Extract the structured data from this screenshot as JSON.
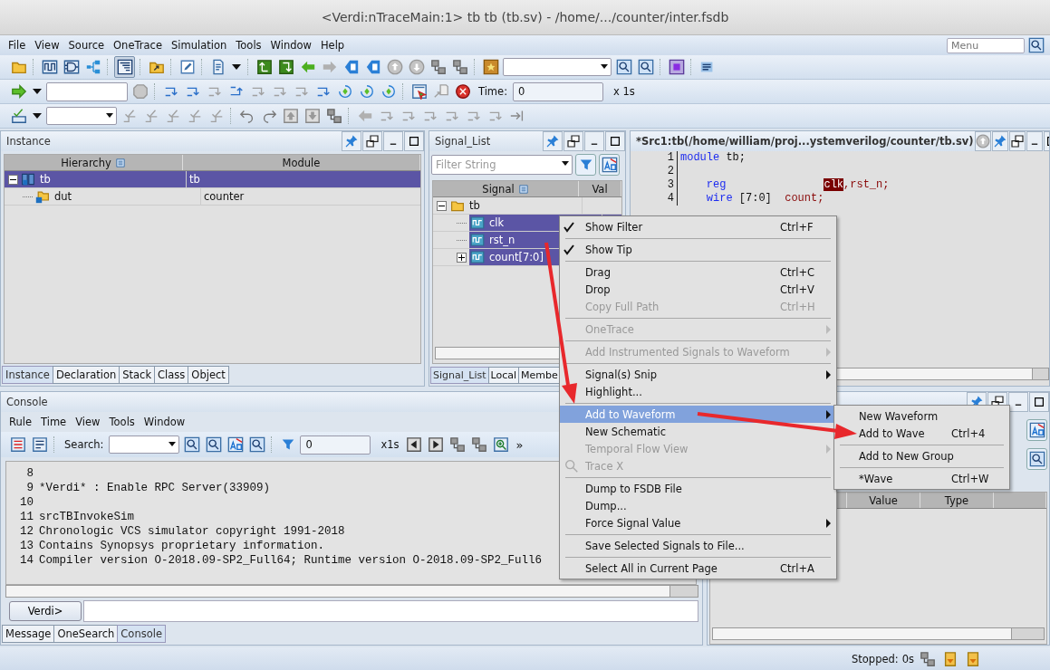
{
  "window": {
    "title": "<Verdi:nTraceMain:1> tb tb (tb.sv) - /home/.../counter/inter.fsdb"
  },
  "menu_bar": {
    "items": [
      "File",
      "View",
      "Source",
      "OneTrace",
      "Simulation",
      "Tools",
      "Window",
      "Help"
    ],
    "search": {
      "placeholder": "Menu"
    }
  },
  "toolbar_time": {
    "label": "Time:",
    "value": "0",
    "unit": "x 1s"
  },
  "instance_panel": {
    "title": "Instance",
    "columns": [
      "Hierarchy",
      "Module"
    ],
    "rows": [
      {
        "name": "tb",
        "module": "tb",
        "selected": true,
        "expanded": true,
        "children": [
          {
            "name": "dut",
            "module": "counter",
            "selected": false
          }
        ]
      }
    ],
    "tabs": [
      {
        "label": "Instance",
        "selected": true
      },
      {
        "label": "Declaration",
        "selected": false
      },
      {
        "label": "Stack",
        "selected": false
      },
      {
        "label": "Class",
        "selected": false
      },
      {
        "label": "Object",
        "selected": false
      }
    ]
  },
  "signal_panel": {
    "title": "Signal_List",
    "filter": {
      "placeholder": "Filter String"
    },
    "columns": [
      "Signal",
      "Val"
    ],
    "tree": [
      {
        "name": "tb",
        "selected": false,
        "expanded": true,
        "children": [
          {
            "name": "clk",
            "selected": true
          },
          {
            "name": "rst_n",
            "selected": true
          },
          {
            "name": "count[7:0]",
            "selected": true,
            "expanded": false
          }
        ]
      }
    ],
    "tabs": [
      {
        "label": "Signal_List",
        "selected": true
      },
      {
        "label": "Local",
        "selected": false
      },
      {
        "label": "Membe",
        "selected": false
      }
    ]
  },
  "source_panel": {
    "title": "*Src1:tb(/home/william/proj...ystemverilog/counter/tb.sv)",
    "lines": [
      {
        "number": "1",
        "tokens": [
          {
            "text": "module",
            "kind": "keyword"
          },
          {
            "text": " tb;",
            "kind": "plain"
          }
        ]
      },
      {
        "number": "2"
      },
      {
        "number": "3",
        "tokens": [
          {
            "text": "    reg               ",
            "kind": "keyword"
          },
          {
            "text": "clk",
            "kind": "highlight"
          },
          {
            "text": ",rst_n;",
            "kind": "identifier"
          }
        ]
      },
      {
        "number": "4",
        "tokens": [
          {
            "text": "    wire",
            "kind": "keyword"
          },
          {
            "text": " [7:0]  ",
            "kind": "plain"
          },
          {
            "text": "count;",
            "kind": "identifier"
          }
        ]
      }
    ]
  },
  "console_panel": {
    "title": "Console",
    "menu": [
      "Rule",
      "Time",
      "View",
      "Tools",
      "Window"
    ],
    "search_label": "Search:",
    "field_value": "0",
    "unit": "x1s",
    "more": "»",
    "lines": [
      {
        "number": "8"
      },
      {
        "number": "9",
        "text": "*Verdi* : Enable RPC Server(33909)"
      },
      {
        "number": "10"
      },
      {
        "number": "11",
        "text": "srcTBInvokeSim"
      },
      {
        "number": "12",
        "text": "Chronologic VCS simulator copyright 1991-2018"
      },
      {
        "number": "13",
        "text": "Contains Synopsys proprietary information."
      },
      {
        "number": "14",
        "text": "Compiler version O-2018.09-SP2_Full64; Runtime version O-2018.09-SP2_Full6"
      }
    ],
    "prompt_button": "Verdi>",
    "tabs": [
      {
        "label": "Message",
        "selected": false
      },
      {
        "label": "OneSearch",
        "selected": false
      },
      {
        "label": "Console",
        "selected": true
      }
    ]
  },
  "wave_panel": {
    "columns": [
      "Value",
      "Type"
    ]
  },
  "context_menu": {
    "items": [
      {
        "kind": "item",
        "label": "Show Filter",
        "shortcut": "Ctrl+F",
        "checked": true,
        "disabled": false,
        "submenu": false,
        "selected": false
      },
      {
        "kind": "separator"
      },
      {
        "kind": "item",
        "label": "Show Tip",
        "checked": true,
        "disabled": false,
        "submenu": false,
        "selected": false
      },
      {
        "kind": "separator"
      },
      {
        "kind": "item",
        "label": "Drag",
        "shortcut": "Ctrl+C",
        "checked": false,
        "disabled": false,
        "submenu": false,
        "selected": false
      },
      {
        "kind": "item",
        "label": "Drop",
        "shortcut": "Ctrl+V",
        "checked": false,
        "disabled": false,
        "submenu": false,
        "selected": false
      },
      {
        "kind": "item",
        "label": "Copy Full Path",
        "shortcut": "Ctrl+H",
        "checked": false,
        "disabled": true,
        "submenu": false,
        "selected": false
      },
      {
        "kind": "separator"
      },
      {
        "kind": "item",
        "label": "OneTrace",
        "checked": false,
        "disabled": true,
        "submenu": true,
        "selected": false
      },
      {
        "kind": "separator"
      },
      {
        "kind": "item",
        "label": "Add Instrumented Signals to Waveform",
        "checked": false,
        "disabled": true,
        "submenu": true,
        "selected": false
      },
      {
        "kind": "separator"
      },
      {
        "kind": "item",
        "label": "Signal(s) Snip",
        "checked": false,
        "disabled": false,
        "submenu": true,
        "selected": false
      },
      {
        "kind": "item",
        "label": "Highlight...",
        "checked": false,
        "disabled": false,
        "submenu": false,
        "selected": false
      },
      {
        "kind": "separator"
      },
      {
        "kind": "item",
        "label": "Add to Waveform",
        "checked": false,
        "disabled": false,
        "submenu": true,
        "selected": true
      },
      {
        "kind": "item",
        "label": "New Schematic",
        "checked": false,
        "disabled": false,
        "submenu": false,
        "selected": false
      },
      {
        "kind": "item",
        "label": "Temporal Flow View",
        "checked": false,
        "disabled": true,
        "submenu": true,
        "selected": false
      },
      {
        "kind": "icon_item",
        "label": "Trace X",
        "checked": false,
        "disabled": true,
        "submenu": false,
        "selected": false
      },
      {
        "kind": "separator"
      },
      {
        "kind": "item",
        "label": "Dump to FSDB File",
        "checked": false,
        "disabled": false,
        "submenu": false,
        "selected": false
      },
      {
        "kind": "item",
        "label": "Dump...",
        "checked": false,
        "disabled": false,
        "submenu": false,
        "selected": false
      },
      {
        "kind": "item",
        "label": "Force Signal Value",
        "checked": false,
        "disabled": false,
        "submenu": true,
        "selected": false
      },
      {
        "kind": "separator"
      },
      {
        "kind": "item",
        "label": "Save Selected Signals to File...",
        "checked": false,
        "disabled": false,
        "submenu": false,
        "selected": false
      },
      {
        "kind": "separator"
      },
      {
        "kind": "item",
        "label": "Select All in Current Page",
        "shortcut": "Ctrl+A",
        "checked": false,
        "disabled": false,
        "submenu": false,
        "selected": false
      }
    ]
  },
  "submenu": {
    "items": [
      {
        "kind": "item",
        "label": "New Waveform"
      },
      {
        "kind": "item",
        "label": "Add to Wave",
        "shortcut": "Ctrl+4"
      },
      {
        "kind": "separator"
      },
      {
        "kind": "item",
        "label": "Add to New Group"
      },
      {
        "kind": "separator"
      },
      {
        "kind": "item",
        "label": "*Wave",
        "shortcut": "Ctrl+W"
      }
    ]
  },
  "status_bar": {
    "text": "Stopped:",
    "time": "0s"
  }
}
